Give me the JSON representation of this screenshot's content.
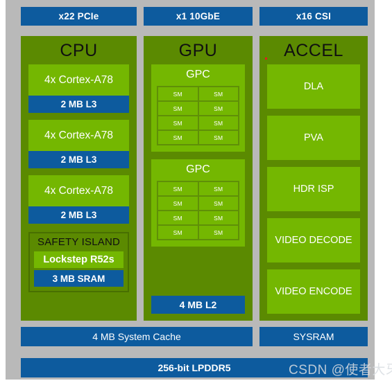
{
  "colors": {
    "panel_gray": "#b9b9b9",
    "dark_green": "#5b8a01",
    "nvidia_green": "#74b701",
    "blue": "#0d5b9e",
    "sm_grid_green": "#5f8f08",
    "red_dot": "#e02020"
  },
  "io_bars": [
    {
      "label": "x22 PCIe"
    },
    {
      "label": "x1 10GbE"
    },
    {
      "label": "x16 CSI"
    }
  ],
  "cpu": {
    "title": "CPU",
    "clusters": [
      {
        "core_label": "4x Cortex-A78",
        "cache_label": "2 MB L3"
      },
      {
        "core_label": "4x Cortex-A78",
        "cache_label": "2 MB L3"
      },
      {
        "core_label": "4x Cortex-A78",
        "cache_label": "2 MB L3"
      }
    ],
    "safety_island": {
      "title": "SAFETY ISLAND",
      "lockstep_label": "Lockstep R52s",
      "sram_label": "3 MB SRAM"
    }
  },
  "gpu": {
    "title": "GPU",
    "gpcs": [
      {
        "title": "GPC",
        "sms": [
          "SM",
          "SM",
          "SM",
          "SM",
          "SM",
          "SM",
          "SM",
          "SM"
        ]
      },
      {
        "title": "GPC",
        "sms": [
          "SM",
          "SM",
          "SM",
          "SM",
          "SM",
          "SM",
          "SM",
          "SM"
        ]
      }
    ],
    "l2_label": "4 MB L2"
  },
  "accel": {
    "title": "ACCEL",
    "blocks": [
      {
        "label": "DLA"
      },
      {
        "label": "PVA"
      },
      {
        "label": "HDR ISP"
      },
      {
        "label": "VIDEO DECODE"
      },
      {
        "label": "VIDEO ENCODE"
      }
    ]
  },
  "memory": {
    "system_cache_label": "4 MB System Cache",
    "sysram_label": "SYSRAM",
    "dram_label": "256-bit LPDDR5"
  },
  "watermark": {
    "text": "CSDN @使者大牙"
  }
}
